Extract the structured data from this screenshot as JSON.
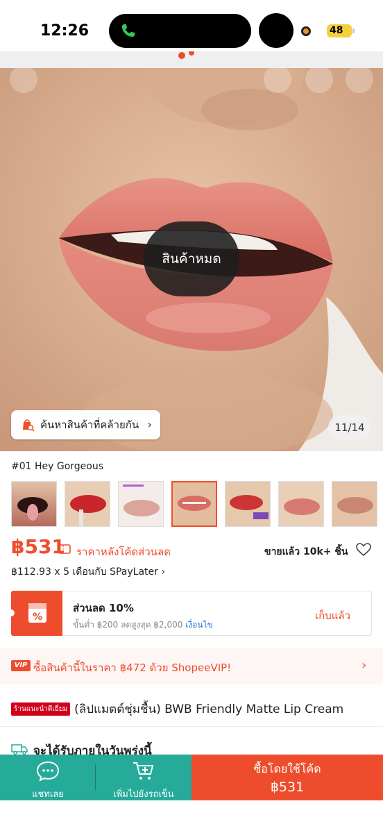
{
  "status_bar": {
    "time": "12:26",
    "battery": "48"
  },
  "hero": {
    "soldout_label": "สินค้าหมด",
    "similar_label": "ค้นหาสินค้าที่คล้ายกัน",
    "counter": "11/14"
  },
  "variant": {
    "name": "#01 Hey Gorgeous",
    "thumbnail_count": 8,
    "selected_index": 3
  },
  "price": {
    "amount": "฿531",
    "note": "ราคาหลังโค้ดส่วนลด",
    "sold": "ขายแล้ว 10k+ ชิ้น",
    "installment": "฿112.93 x 5 เดือนกับ SPayLater"
  },
  "voucher": {
    "title": "ส่วนลด 10%",
    "condition": "ขั้นต่ำ ฿200 ลดสูงสุด ฿2,000",
    "condition_link": "เงื่อนไข",
    "claim_label": "เก็บแล้ว"
  },
  "vip": {
    "badge": "VIP",
    "text": "ซื้อสินค้านี้ในราคา ฿472 ด้วย ShopeeVIP!"
  },
  "product": {
    "store_badge": "ร้านแนะนำดีเยี่ยม",
    "title": "(ลิปแมตต์ชุ่มชื้น) BWB Friendly Matte Lip Cream"
  },
  "delivery": {
    "text": "จะได้รับภายในวันพรุ่งนี้"
  },
  "bottom_bar": {
    "chat_label": "แชทเลย",
    "cart_label": "เพิ่มไปยังรถเข็น",
    "buy_label": "ซื้อโดยใช้โค้ด",
    "buy_price": "฿531"
  },
  "colors": {
    "accent": "#ee4d2d",
    "teal": "#26aa99",
    "link": "#2673dd"
  }
}
